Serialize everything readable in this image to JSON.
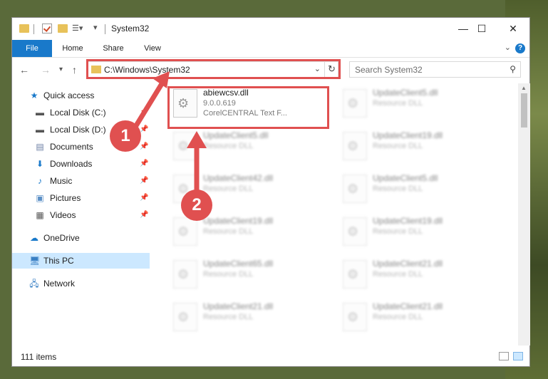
{
  "window": {
    "title": "System32",
    "controls": {
      "minimize": "—",
      "maximize": "☐",
      "close": "✕"
    }
  },
  "ribbon": {
    "tabs": [
      "File",
      "Home",
      "Share",
      "View"
    ],
    "help": "?"
  },
  "nav": {
    "address": "C:\\Windows\\System32",
    "search_placeholder": "Search System32"
  },
  "sidebar": {
    "items": [
      {
        "label": "Quick access",
        "icon": "star-icon"
      },
      {
        "label": "Local Disk (C:)",
        "icon": "drive-icon"
      },
      {
        "label": "Local Disk (D:)",
        "icon": "drive-icon"
      },
      {
        "label": "Documents",
        "icon": "documents-icon"
      },
      {
        "label": "Downloads",
        "icon": "download-icon"
      },
      {
        "label": "Music",
        "icon": "music-icon"
      },
      {
        "label": "Pictures",
        "icon": "pictures-icon"
      },
      {
        "label": "Videos",
        "icon": "videos-icon"
      },
      {
        "label": "OneDrive",
        "icon": "cloud-icon"
      },
      {
        "label": "This PC",
        "icon": "computer-icon"
      },
      {
        "label": "Network",
        "icon": "network-icon"
      }
    ]
  },
  "files": {
    "highlighted": {
      "name": "abiewcsv.dll",
      "version": "9.0.0.619",
      "description": "CorelCENTRAL Text F..."
    },
    "left_column": [
      {
        "name": "UpdateClient5.dll",
        "type": "Resource DLL"
      },
      {
        "name": "UpdateClient42.dll",
        "type": "Resource DLL"
      },
      {
        "name": "UpdateClient19.dll",
        "type": "Resource DLL"
      },
      {
        "name": "UpdateClient65.dll",
        "type": "Resource DLL"
      },
      {
        "name": "UpdateClient21.dll",
        "type": "Resource DLL"
      }
    ],
    "right_column": [
      {
        "name": "UpdateClient5.dll",
        "type": "Resource DLL"
      },
      {
        "name": "UpdateClient19.dll",
        "type": "Resource DLL"
      },
      {
        "name": "UpdateClient5.dll",
        "type": "Resource DLL"
      },
      {
        "name": "UpdateClient19.dll",
        "type": "Resource DLL"
      },
      {
        "name": "UpdateClient21.dll",
        "type": "Resource DLL"
      },
      {
        "name": "UpdateClient21.dll",
        "type": "Resource DLL"
      }
    ]
  },
  "status": {
    "item_count": "111 items"
  },
  "annotations": {
    "step1": "1",
    "step2": "2",
    "color": "#e05050"
  }
}
